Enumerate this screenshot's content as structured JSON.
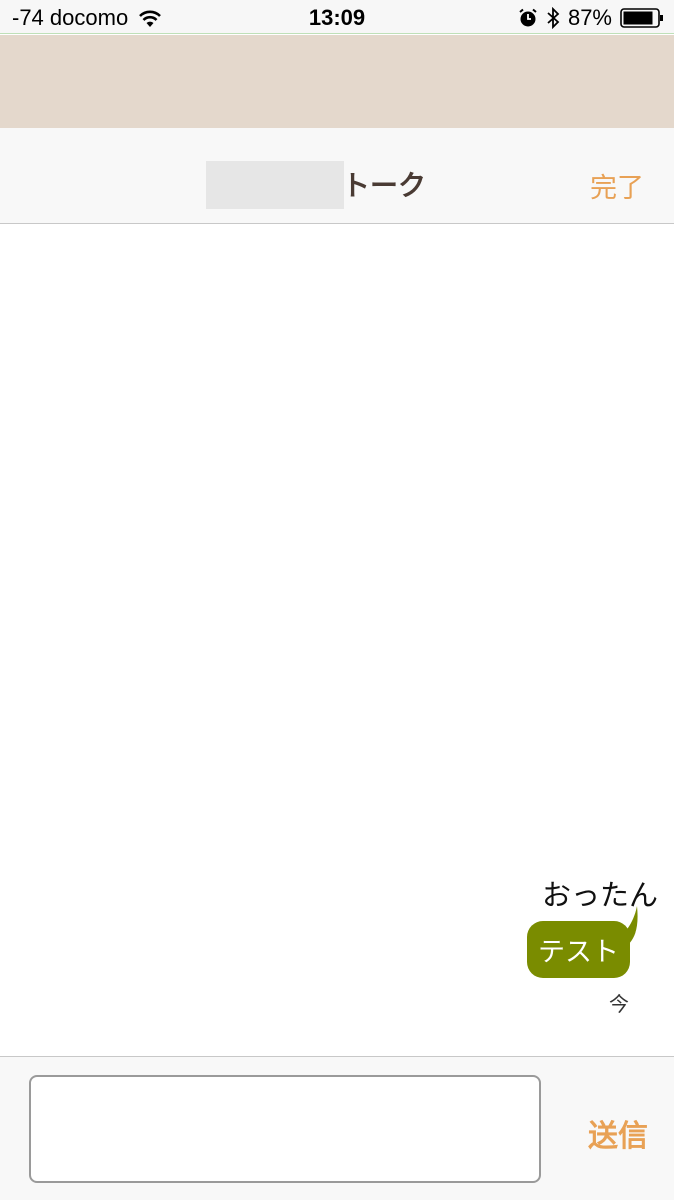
{
  "status_bar": {
    "carrier": "-74 docomo",
    "time": "13:09",
    "battery": "87%"
  },
  "navbar": {
    "title": "トーク",
    "done_label": "完了"
  },
  "conversation": {
    "messages": [
      {
        "sender": "おったん",
        "text": "テスト",
        "time": "今",
        "color": "#7a8c00"
      }
    ]
  },
  "input_bar": {
    "value": "",
    "send_label": "送信"
  },
  "colors": {
    "accent": "#e8a155",
    "banner": "#e4d8cc",
    "bubble": "#7a8c00"
  }
}
